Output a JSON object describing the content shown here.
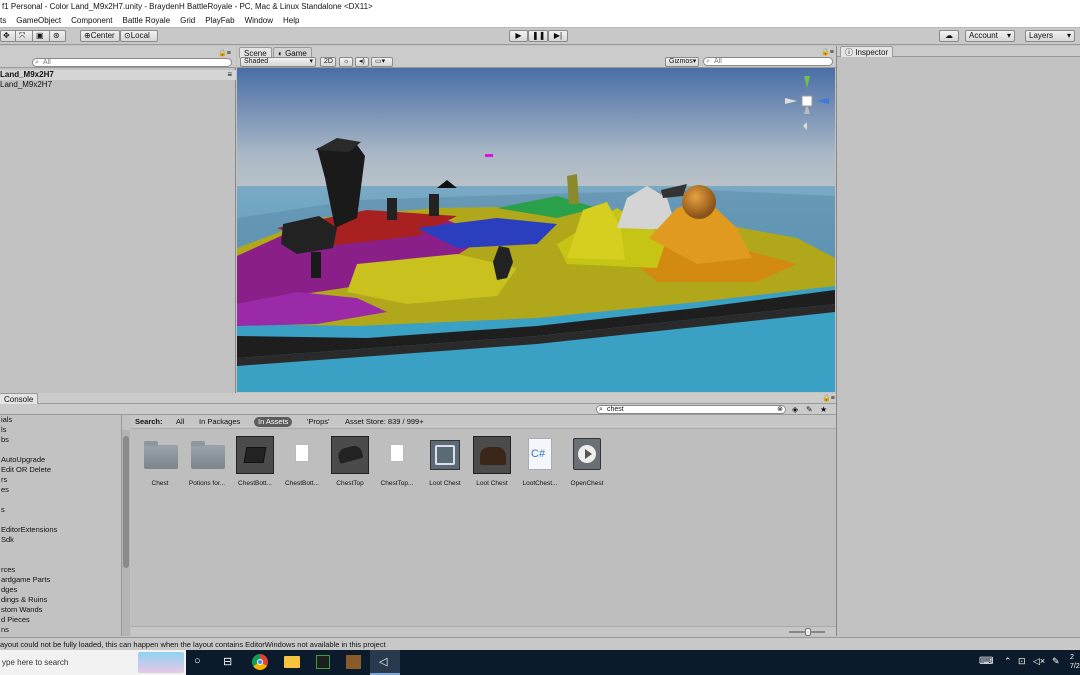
{
  "window": {
    "title": "f1 Personal - Color Land_M9x2H7.unity - BraydenH BattleRoyale - PC, Mac & Linux Standalone <DX11>"
  },
  "menu": [
    "ts",
    "GameObject",
    "Component",
    "Battle Royale",
    "Grid",
    "PlayFab",
    "Window",
    "Help"
  ],
  "toolbar": {
    "center_label": "Center",
    "local_label": "Local",
    "account_label": "Account",
    "layers_label": "Layers"
  },
  "hierarchy": {
    "scene_name": "Land_M9x2H7",
    "child_name": "Land_M9x2H7",
    "search_placeholder": "All"
  },
  "scene_view": {
    "tab_scene": "Scene",
    "tab_game": "Game",
    "shading_mode": "Shaded",
    "mode_2d": "2D",
    "gizmos_label": "Gizmos",
    "search_placeholder": "All"
  },
  "inspector": {
    "tab_label": "Inspector"
  },
  "bottom": {
    "console_tab": "Console",
    "search_value": "chest",
    "search_label": "Search:",
    "filters": [
      "All",
      "In Packages",
      "In Assets",
      "'Props'",
      "Asset Store: 839 / 999+"
    ],
    "active_filter": "In Assets",
    "tree_items": [
      "ials",
      "ls",
      "bs",
      "",
      "AutoUpgrade",
      "Edit OR Delete",
      "rs",
      "es",
      "",
      "s",
      "",
      "EditorExtensions",
      "Sdk",
      "",
      "",
      "rces",
      "ardgame Parts",
      "dges",
      "dings & Ruins",
      "stom Wands",
      "d Pieces",
      "ns"
    ],
    "assets": [
      {
        "name": "Chest",
        "kind": "folder"
      },
      {
        "name": "Potions for...",
        "kind": "folder"
      },
      {
        "name": "ChestBott...",
        "kind": "model"
      },
      {
        "name": "ChestBott...",
        "kind": "file"
      },
      {
        "name": "ChestTop",
        "kind": "model"
      },
      {
        "name": "ChestTop...",
        "kind": "file"
      },
      {
        "name": "Loot Chest",
        "kind": "prefab"
      },
      {
        "name": "Loot Chest",
        "kind": "model"
      },
      {
        "name": "LootChest...",
        "kind": "script"
      },
      {
        "name": "OpenChest",
        "kind": "animation"
      }
    ],
    "cs_glyph": "C#"
  },
  "status": {
    "message": "ayout could not be fully loaded, this can happen when the layout contains EditorWindows not available in this project"
  },
  "taskbar": {
    "search_placeholder": "ype here to search",
    "clock_time": "2",
    "clock_date": "7/2"
  },
  "colors": {
    "unity_bg": "#c2c2c2",
    "active_filter_bg": "#5c5c5c",
    "taskbar_bg": "#0c1b2b",
    "sky_top": "#4a6ea6",
    "water": "#3a9fc2"
  }
}
